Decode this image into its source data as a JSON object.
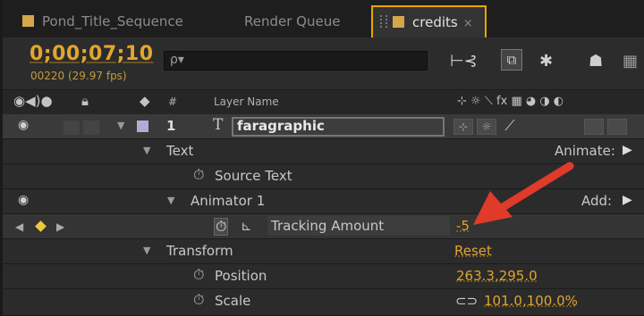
{
  "tabs": [
    {
      "label": "Pond_Title_Sequence"
    },
    {
      "label": "Render Queue"
    },
    {
      "label": "credits",
      "close": "×"
    }
  ],
  "header": {
    "timecode": "0;00;07;10",
    "frame_info": "00220 (29.97 fps)",
    "search_placeholder": "ρ▾"
  },
  "columns": {
    "number": "#",
    "layer_name": "Layer Name",
    "switch_icons": "⊹ ☼ ⟍ fx ▦ ◕ ◑ ◐"
  },
  "layer": {
    "number": "1",
    "type_glyph": "T",
    "name": "faragraphic"
  },
  "properties": {
    "text": "Text",
    "animate": "Animate:",
    "source_text": "Source Text",
    "animator": "Animator 1",
    "add": "Add:",
    "tracking_amount": "Tracking Amount",
    "tracking_value": "-5",
    "transform": "Transform",
    "reset": "Reset",
    "position": "Position",
    "position_value": "263.3,295.0",
    "scale": "Scale",
    "scale_value": "101.0,100.0%"
  },
  "colors": {
    "accent": "#e8a600",
    "value": "#e0a42c",
    "label_color": "#b7a8d8",
    "annotation_arrow": "#e03a2a"
  }
}
